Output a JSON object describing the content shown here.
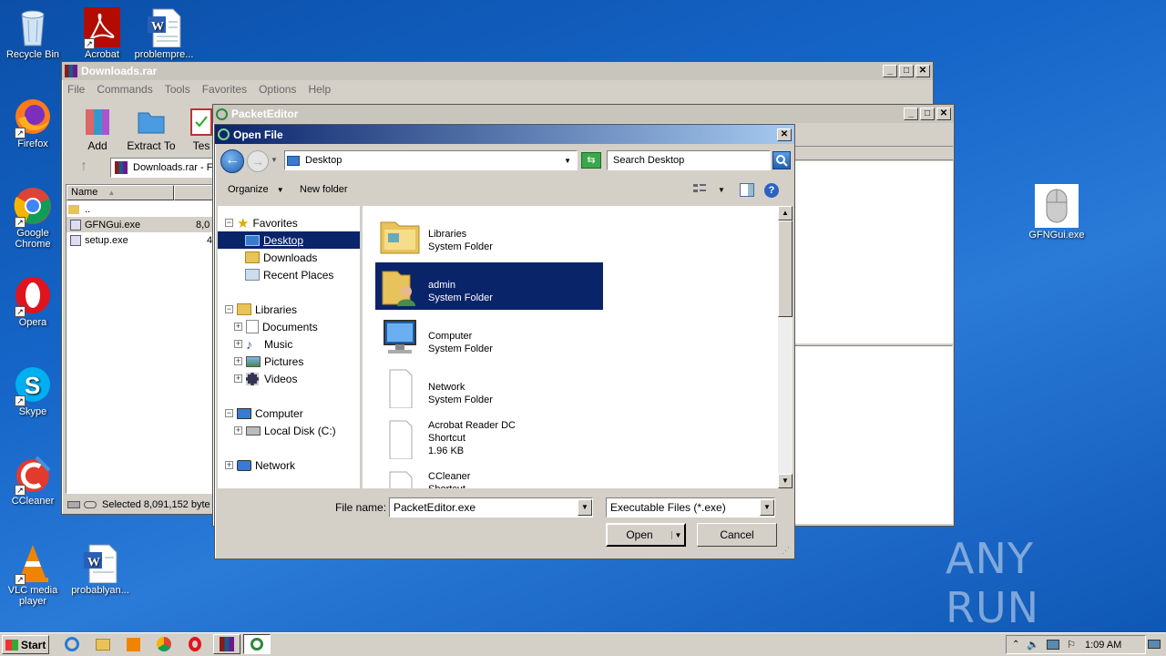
{
  "desktop": {
    "icons": [
      {
        "label": "Recycle Bin"
      },
      {
        "label": "Acrobat"
      },
      {
        "label": "problempre..."
      },
      {
        "label": "Firefox"
      },
      {
        "label": "Google Chrome"
      },
      {
        "label": "Opera"
      },
      {
        "label": "Skype"
      },
      {
        "label": "CCleaner"
      },
      {
        "label": "VLC media player"
      },
      {
        "label": "probablyan..."
      },
      {
        "label": "GFNGui.exe"
      }
    ],
    "watermark": "ANY RUN"
  },
  "winrar": {
    "title": "Downloads.rar",
    "menu": [
      "File",
      "Commands",
      "Tools",
      "Favorites",
      "Options",
      "Help"
    ],
    "toolbar": [
      "Add",
      "Extract To",
      "Tes"
    ],
    "path": "Downloads.rar - F",
    "col_name": "Name",
    "files": [
      {
        "name": "..",
        "size": ""
      },
      {
        "name": "GFNGui.exe",
        "size": "8,0"
      },
      {
        "name": "setup.exe",
        "size": "4"
      }
    ],
    "status": "Selected 8,091,152 byte"
  },
  "packeteditor": {
    "title": "PacketEditor"
  },
  "dialog": {
    "title": "Open File",
    "location": "Desktop",
    "search_placeholder": "Search Desktop",
    "organize": "Organize",
    "new_folder": "New folder",
    "tree": {
      "favorites": "Favorites",
      "desktop": "Desktop",
      "downloads": "Downloads",
      "recent": "Recent Places",
      "libraries": "Libraries",
      "documents": "Documents",
      "music": "Music",
      "pictures": "Pictures",
      "videos": "Videos",
      "computer": "Computer",
      "localdisk": "Local Disk (C:)",
      "network": "Network"
    },
    "items": [
      {
        "name": "Libraries",
        "type": "System Folder",
        "extra": ""
      },
      {
        "name": "admin",
        "type": "System Folder",
        "extra": ""
      },
      {
        "name": "Computer",
        "type": "System Folder",
        "extra": ""
      },
      {
        "name": "Network",
        "type": "System Folder",
        "extra": ""
      },
      {
        "name": "Acrobat Reader DC",
        "type": "Shortcut",
        "extra": "1.96 KB"
      },
      {
        "name": "CCleaner",
        "type": "Shortcut",
        "extra": ""
      }
    ],
    "filename_label": "File name:",
    "filename_value": "PacketEditor.exe",
    "filetype_value": "Executable Files (*.exe)",
    "open_label": "Open",
    "cancel_label": "Cancel"
  },
  "taskbar": {
    "start_label": "Start",
    "clock": "1:09 AM"
  }
}
